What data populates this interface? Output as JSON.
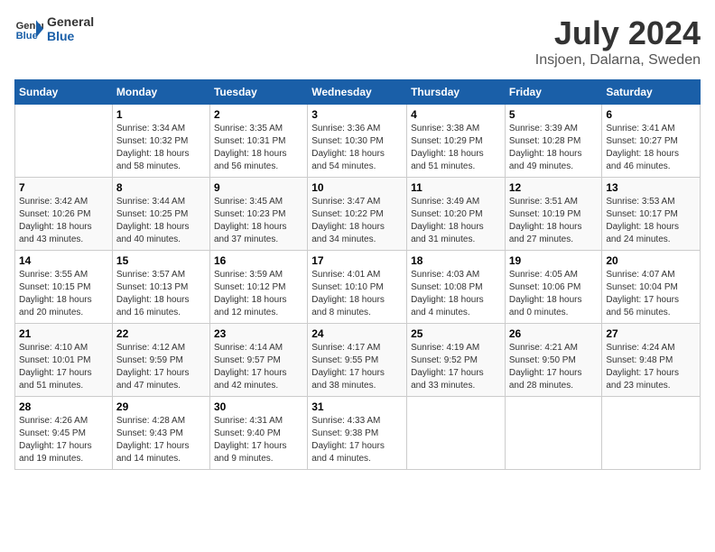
{
  "logo": {
    "text_general": "General",
    "text_blue": "Blue"
  },
  "header": {
    "title": "July 2024",
    "subtitle": "Insjoen, Dalarna, Sweden"
  },
  "weekdays": [
    "Sunday",
    "Monday",
    "Tuesday",
    "Wednesday",
    "Thursday",
    "Friday",
    "Saturday"
  ],
  "weeks": [
    [
      {
        "day": "",
        "info": ""
      },
      {
        "day": "1",
        "info": "Sunrise: 3:34 AM\nSunset: 10:32 PM\nDaylight: 18 hours\nand 58 minutes."
      },
      {
        "day": "2",
        "info": "Sunrise: 3:35 AM\nSunset: 10:31 PM\nDaylight: 18 hours\nand 56 minutes."
      },
      {
        "day": "3",
        "info": "Sunrise: 3:36 AM\nSunset: 10:30 PM\nDaylight: 18 hours\nand 54 minutes."
      },
      {
        "day": "4",
        "info": "Sunrise: 3:38 AM\nSunset: 10:29 PM\nDaylight: 18 hours\nand 51 minutes."
      },
      {
        "day": "5",
        "info": "Sunrise: 3:39 AM\nSunset: 10:28 PM\nDaylight: 18 hours\nand 49 minutes."
      },
      {
        "day": "6",
        "info": "Sunrise: 3:41 AM\nSunset: 10:27 PM\nDaylight: 18 hours\nand 46 minutes."
      }
    ],
    [
      {
        "day": "7",
        "info": "Sunrise: 3:42 AM\nSunset: 10:26 PM\nDaylight: 18 hours\nand 43 minutes."
      },
      {
        "day": "8",
        "info": "Sunrise: 3:44 AM\nSunset: 10:25 PM\nDaylight: 18 hours\nand 40 minutes."
      },
      {
        "day": "9",
        "info": "Sunrise: 3:45 AM\nSunset: 10:23 PM\nDaylight: 18 hours\nand 37 minutes."
      },
      {
        "day": "10",
        "info": "Sunrise: 3:47 AM\nSunset: 10:22 PM\nDaylight: 18 hours\nand 34 minutes."
      },
      {
        "day": "11",
        "info": "Sunrise: 3:49 AM\nSunset: 10:20 PM\nDaylight: 18 hours\nand 31 minutes."
      },
      {
        "day": "12",
        "info": "Sunrise: 3:51 AM\nSunset: 10:19 PM\nDaylight: 18 hours\nand 27 minutes."
      },
      {
        "day": "13",
        "info": "Sunrise: 3:53 AM\nSunset: 10:17 PM\nDaylight: 18 hours\nand 24 minutes."
      }
    ],
    [
      {
        "day": "14",
        "info": "Sunrise: 3:55 AM\nSunset: 10:15 PM\nDaylight: 18 hours\nand 20 minutes."
      },
      {
        "day": "15",
        "info": "Sunrise: 3:57 AM\nSunset: 10:13 PM\nDaylight: 18 hours\nand 16 minutes."
      },
      {
        "day": "16",
        "info": "Sunrise: 3:59 AM\nSunset: 10:12 PM\nDaylight: 18 hours\nand 12 minutes."
      },
      {
        "day": "17",
        "info": "Sunrise: 4:01 AM\nSunset: 10:10 PM\nDaylight: 18 hours\nand 8 minutes."
      },
      {
        "day": "18",
        "info": "Sunrise: 4:03 AM\nSunset: 10:08 PM\nDaylight: 18 hours\nand 4 minutes."
      },
      {
        "day": "19",
        "info": "Sunrise: 4:05 AM\nSunset: 10:06 PM\nDaylight: 18 hours\nand 0 minutes."
      },
      {
        "day": "20",
        "info": "Sunrise: 4:07 AM\nSunset: 10:04 PM\nDaylight: 17 hours\nand 56 minutes."
      }
    ],
    [
      {
        "day": "21",
        "info": "Sunrise: 4:10 AM\nSunset: 10:01 PM\nDaylight: 17 hours\nand 51 minutes."
      },
      {
        "day": "22",
        "info": "Sunrise: 4:12 AM\nSunset: 9:59 PM\nDaylight: 17 hours\nand 47 minutes."
      },
      {
        "day": "23",
        "info": "Sunrise: 4:14 AM\nSunset: 9:57 PM\nDaylight: 17 hours\nand 42 minutes."
      },
      {
        "day": "24",
        "info": "Sunrise: 4:17 AM\nSunset: 9:55 PM\nDaylight: 17 hours\nand 38 minutes."
      },
      {
        "day": "25",
        "info": "Sunrise: 4:19 AM\nSunset: 9:52 PM\nDaylight: 17 hours\nand 33 minutes."
      },
      {
        "day": "26",
        "info": "Sunrise: 4:21 AM\nSunset: 9:50 PM\nDaylight: 17 hours\nand 28 minutes."
      },
      {
        "day": "27",
        "info": "Sunrise: 4:24 AM\nSunset: 9:48 PM\nDaylight: 17 hours\nand 23 minutes."
      }
    ],
    [
      {
        "day": "28",
        "info": "Sunrise: 4:26 AM\nSunset: 9:45 PM\nDaylight: 17 hours\nand 19 minutes."
      },
      {
        "day": "29",
        "info": "Sunrise: 4:28 AM\nSunset: 9:43 PM\nDaylight: 17 hours\nand 14 minutes."
      },
      {
        "day": "30",
        "info": "Sunrise: 4:31 AM\nSunset: 9:40 PM\nDaylight: 17 hours\nand 9 minutes."
      },
      {
        "day": "31",
        "info": "Sunrise: 4:33 AM\nSunset: 9:38 PM\nDaylight: 17 hours\nand 4 minutes."
      },
      {
        "day": "",
        "info": ""
      },
      {
        "day": "",
        "info": ""
      },
      {
        "day": "",
        "info": ""
      }
    ]
  ]
}
